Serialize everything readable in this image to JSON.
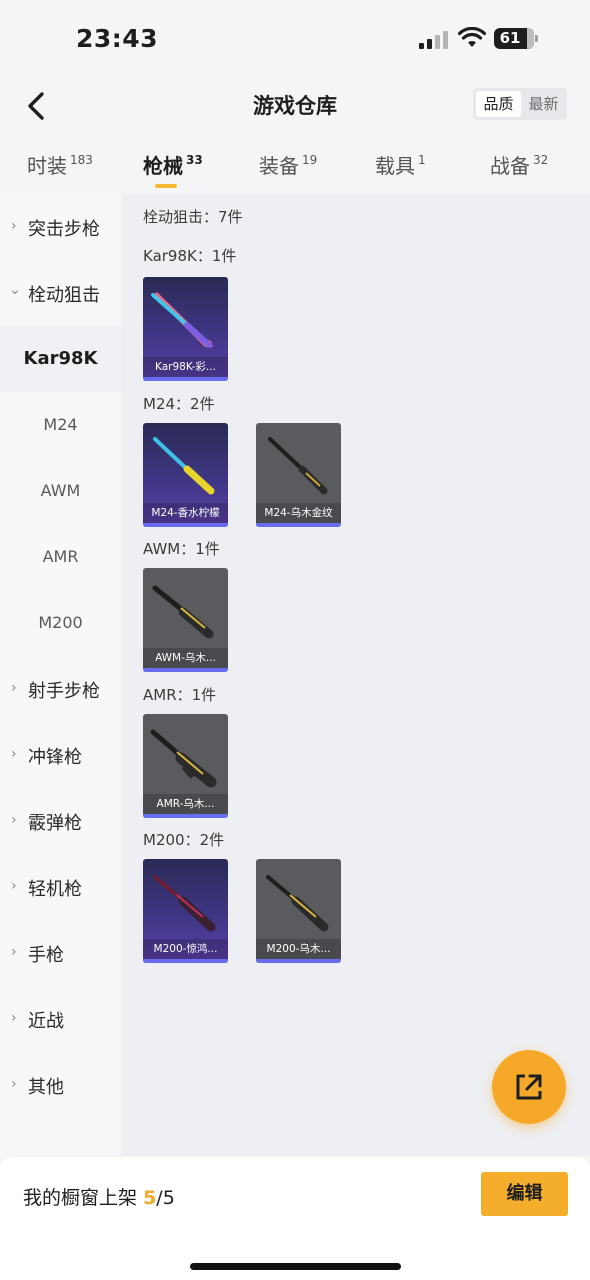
{
  "status_bar": {
    "time": "23:43",
    "battery": "61"
  },
  "header": {
    "title": "游戏仓库",
    "sort_options": [
      "品质",
      "最新"
    ]
  },
  "tabs": [
    {
      "label": "时装",
      "count": "183"
    },
    {
      "label": "枪械",
      "count": "33"
    },
    {
      "label": "装备",
      "count": "19"
    },
    {
      "label": "载具",
      "count": "1"
    },
    {
      "label": "战备",
      "count": "32"
    }
  ],
  "sidebar": {
    "categories_top": [
      {
        "label": "突击步枪"
      },
      {
        "label": "栓动狙击"
      }
    ],
    "subitems": [
      "Kar98K",
      "M24",
      "AWM",
      "AMR",
      "M200"
    ],
    "categories_bottom": [
      {
        "label": "射手步枪"
      },
      {
        "label": "冲锋枪"
      },
      {
        "label": "霰弹枪"
      },
      {
        "label": "轻机枪"
      },
      {
        "label": "手枪"
      },
      {
        "label": "近战"
      },
      {
        "label": "其他"
      }
    ]
  },
  "content": {
    "summary": "栓动狙击：7件",
    "groups": [
      {
        "title": "Kar98K：1件",
        "items": [
          {
            "name": "Kar98K-彩...",
            "style": "purple"
          }
        ]
      },
      {
        "title": "M24：2件",
        "items": [
          {
            "name": "M24-香水柠檬",
            "style": "purple"
          },
          {
            "name": "M24-乌木金纹",
            "style": "gray"
          }
        ]
      },
      {
        "title": "AWM：1件",
        "items": [
          {
            "name": "AWM-乌木...",
            "style": "gray"
          }
        ]
      },
      {
        "title": "AMR：1件",
        "items": [
          {
            "name": "AMR-乌木...",
            "style": "gray"
          }
        ]
      },
      {
        "title": "M200：2件",
        "items": [
          {
            "name": "M200-惊鸿...",
            "style": "purple"
          },
          {
            "name": "M200-乌木...",
            "style": "gray"
          }
        ]
      }
    ]
  },
  "bottom_bar": {
    "label": "我的橱窗上架",
    "current": "5",
    "total": "/5",
    "edit_label": "编辑"
  },
  "colors": {
    "accent": "#f5ae2b",
    "rarity_bar": "#6a6cf0"
  }
}
